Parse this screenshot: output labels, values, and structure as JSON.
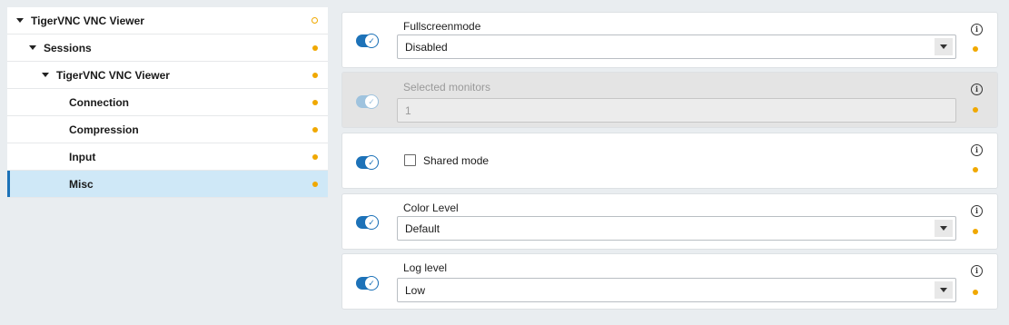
{
  "tree": {
    "items": [
      {
        "label": "TigerVNC VNC Viewer",
        "level": 0,
        "caret": true,
        "selected": false,
        "dot": "hollow"
      },
      {
        "label": "Sessions",
        "level": 1,
        "caret": true,
        "selected": false,
        "dot": "filled"
      },
      {
        "label": "TigerVNC VNC Viewer",
        "level": 2,
        "caret": true,
        "selected": false,
        "dot": "filled"
      },
      {
        "label": "Connection",
        "level": 3,
        "caret": false,
        "selected": false,
        "dot": "filled"
      },
      {
        "label": "Compression",
        "level": 3,
        "caret": false,
        "selected": false,
        "dot": "filled"
      },
      {
        "label": "Input",
        "level": 3,
        "caret": false,
        "selected": false,
        "dot": "filled"
      },
      {
        "label": "Misc",
        "level": 3,
        "caret": false,
        "selected": true,
        "dot": "filled"
      }
    ]
  },
  "settings": {
    "fullscreen": {
      "label": "Fullscreenmode",
      "value": "Disabled",
      "enabled": true
    },
    "monitors": {
      "label": "Selected monitors",
      "value": "1",
      "enabled": false
    },
    "shared": {
      "label": "Shared mode",
      "checked": false,
      "enabled": true
    },
    "color": {
      "label": "Color Level",
      "value": "Default",
      "enabled": true
    },
    "log": {
      "label": "Log level",
      "value": "Low",
      "enabled": true
    }
  },
  "icons": {
    "toggle": "toggle-check-icon",
    "info": "info-icon",
    "dropdown": "chevron-down-icon",
    "status": "status-dot-icon"
  },
  "colors": {
    "accent": "#1d72b8",
    "status_dot": "#f0a800",
    "selected_row": "#cfe8f7"
  }
}
